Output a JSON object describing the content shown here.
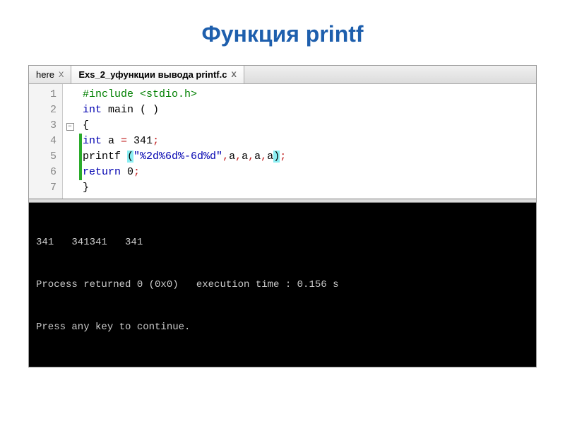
{
  "title": "Функция printf",
  "tabs": [
    {
      "label": "here",
      "active": false
    },
    {
      "label": "Exs_2_уфункции вывода printf.c",
      "active": true
    }
  ],
  "line_numbers": [
    "1",
    "2",
    "3",
    "4",
    "5",
    "6",
    "7"
  ],
  "code": {
    "l1_include": "#include ",
    "l1_hdr": "<stdio.h>",
    "l2_a": "int",
    "l2_b": " main ",
    "l2_c": "( )",
    "l3": "{",
    "l4_a": "int",
    "l4_b": " a ",
    "l4_c": "=",
    "l4_d": " 341",
    "l4_e": ";",
    "l5_a": "printf ",
    "l5_b": "(",
    "l5_c": "\"%2d%6d%-6d%d\"",
    "l5_d": ",",
    "l5_e": "a",
    "l5_f": ",",
    "l5_g": "a",
    "l5_h": ",",
    "l5_i": "a",
    "l5_j": ",",
    "l5_k": "a",
    "l5_l": ")",
    "l5_m": ";",
    "l6_a": "return",
    "l6_b": " 0",
    "l6_c": ";",
    "l7": "}"
  },
  "fold_minus": "−",
  "close_glyph": "X",
  "console": {
    "line1": "341   341341   341",
    "line2": "Process returned 0 (0x0)   execution time : 0.156 s",
    "line3": "Press any key to continue."
  }
}
